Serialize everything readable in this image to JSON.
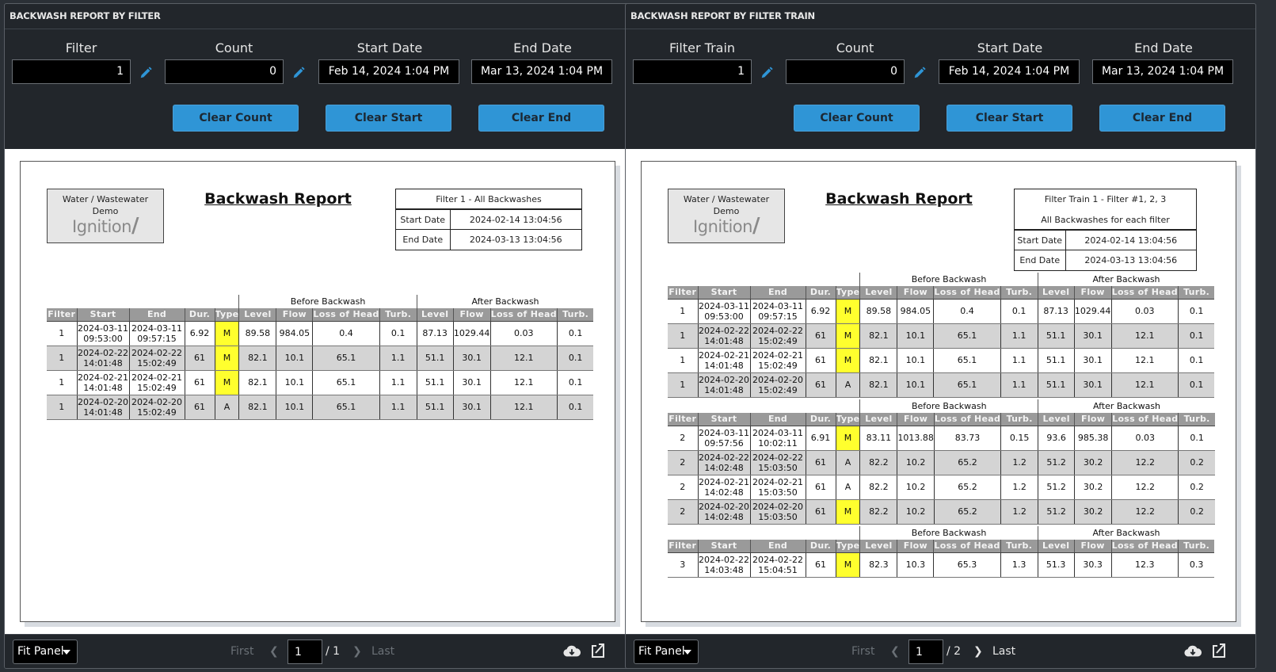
{
  "left": {
    "title": "BACKWASH REPORT BY FILTER",
    "controls": {
      "filter_label": "Filter",
      "filter_value": "1",
      "count_label": "Count",
      "count_value": "0",
      "start_label": "Start Date",
      "start_value": "Feb 14, 2024 1:04 PM",
      "end_label": "End Date",
      "end_value": "Mar 13, 2024 1:04 PM",
      "clear_count": "Clear Count",
      "clear_start": "Clear Start",
      "clear_end": "Clear End"
    },
    "report": {
      "logo_line1": "Water / Wastewater",
      "logo_line2": "Demo",
      "logo_brand": "Ignition",
      "title": "Backwash Report",
      "info_head": [
        "Filter 1 - All Backwashes"
      ],
      "start_label": "Start Date",
      "start_value": "2024-02-14 13:04:56",
      "end_label": "End Date",
      "end_value": "2024-03-13 13:04:56",
      "groups": [
        {
          "rows": [
            [
              "1",
              "2024-03-11",
              "09:53:00",
              "2024-03-11",
              "09:57:15",
              "6.92",
              "M",
              "89.58",
              "984.05",
              "0.4",
              "0.1",
              "87.13",
              "1029.44",
              "0.03",
              "0.1"
            ],
            [
              "1",
              "2024-02-22",
              "14:01:48",
              "2024-02-22",
              "15:02:49",
              "61",
              "M",
              "82.1",
              "10.1",
              "65.1",
              "1.1",
              "51.1",
              "30.1",
              "12.1",
              "0.1"
            ],
            [
              "1",
              "2024-02-21",
              "14:01:48",
              "2024-02-21",
              "15:02:49",
              "61",
              "M",
              "82.1",
              "10.1",
              "65.1",
              "1.1",
              "51.1",
              "30.1",
              "12.1",
              "0.1"
            ],
            [
              "1",
              "2024-02-20",
              "14:01:48",
              "2024-02-20",
              "15:02:49",
              "61",
              "A",
              "82.1",
              "10.1",
              "65.1",
              "1.1",
              "51.1",
              "30.1",
              "12.1",
              "0.1"
            ]
          ]
        }
      ]
    },
    "footer": {
      "zoom_mode": "Fit Panel",
      "first": "First",
      "last": "Last",
      "page": "1",
      "total": "/ 1"
    }
  },
  "right": {
    "title": "BACKWASH REPORT BY FILTER TRAIN",
    "controls": {
      "filter_label": "Filter Train",
      "filter_value": "1",
      "count_label": "Count",
      "count_value": "0",
      "start_label": "Start Date",
      "start_value": "Feb 14, 2024 1:04 PM",
      "end_label": "End Date",
      "end_value": "Mar 13, 2024 1:04 PM",
      "clear_count": "Clear Count",
      "clear_start": "Clear Start",
      "clear_end": "Clear End"
    },
    "report": {
      "logo_line1": "Water / Wastewater",
      "logo_line2": "Demo",
      "logo_brand": "Ignition",
      "title": "Backwash Report",
      "info_head": [
        "Filter Train 1 - Filter #1, 2, 3",
        "All Backwashes for each filter"
      ],
      "start_label": "Start Date",
      "start_value": "2024-02-14 13:04:56",
      "end_label": "End Date",
      "end_value": "2024-03-13 13:04:56",
      "groups": [
        {
          "rows": [
            [
              "1",
              "2024-03-11",
              "09:53:00",
              "2024-03-11",
              "09:57:15",
              "6.92",
              "M",
              "89.58",
              "984.05",
              "0.4",
              "0.1",
              "87.13",
              "1029.44",
              "0.03",
              "0.1"
            ],
            [
              "1",
              "2024-02-22",
              "14:01:48",
              "2024-02-22",
              "15:02:49",
              "61",
              "M",
              "82.1",
              "10.1",
              "65.1",
              "1.1",
              "51.1",
              "30.1",
              "12.1",
              "0.1"
            ],
            [
              "1",
              "2024-02-21",
              "14:01:48",
              "2024-02-21",
              "15:02:49",
              "61",
              "M",
              "82.1",
              "10.1",
              "65.1",
              "1.1",
              "51.1",
              "30.1",
              "12.1",
              "0.1"
            ],
            [
              "1",
              "2024-02-20",
              "14:01:48",
              "2024-02-20",
              "15:02:49",
              "61",
              "A",
              "82.1",
              "10.1",
              "65.1",
              "1.1",
              "51.1",
              "30.1",
              "12.1",
              "0.1"
            ]
          ]
        },
        {
          "rows": [
            [
              "2",
              "2024-03-11",
              "09:57:56",
              "2024-03-11",
              "10:02:11",
              "6.91",
              "M",
              "83.11",
              "1013.88",
              "83.73",
              "0.15",
              "93.6",
              "985.38",
              "0.03",
              "0.1"
            ],
            [
              "2",
              "2024-02-22",
              "14:02:48",
              "2024-02-22",
              "15:03:50",
              "61",
              "A",
              "82.2",
              "10.2",
              "65.2",
              "1.2",
              "51.2",
              "30.2",
              "12.2",
              "0.2"
            ],
            [
              "2",
              "2024-02-21",
              "14:02:48",
              "2024-02-21",
              "15:03:50",
              "61",
              "A",
              "82.2",
              "10.2",
              "65.2",
              "1.2",
              "51.2",
              "30.2",
              "12.2",
              "0.2"
            ],
            [
              "2",
              "2024-02-20",
              "14:02:48",
              "2024-02-20",
              "15:03:50",
              "61",
              "M",
              "82.2",
              "10.2",
              "65.2",
              "1.2",
              "51.2",
              "30.2",
              "12.2",
              "0.2"
            ]
          ]
        },
        {
          "rows": [
            [
              "3",
              "2024-02-22",
              "14:03:48",
              "2024-02-22",
              "15:04:51",
              "61",
              "M",
              "82.3",
              "10.3",
              "65.3",
              "1.3",
              "51.3",
              "30.3",
              "12.3",
              "0.3"
            ]
          ]
        }
      ]
    },
    "footer": {
      "zoom_mode": "Fit Panel",
      "first": "First",
      "last": "Last",
      "page": "1",
      "total": "/ 2"
    }
  },
  "table_labels": {
    "before": "Before Backwash",
    "after": "After Backwash",
    "columns": [
      "Filter",
      "Start",
      "End",
      "Dur.",
      "Type",
      "Level",
      "Flow",
      "Loss of Head",
      "Turb.",
      "Level",
      "Flow",
      "Loss of Head",
      "Turb."
    ]
  },
  "colors": {
    "accent": "#2f95d6",
    "manual_highlight": "#ffff2e",
    "header_gray": "#9a9a9a",
    "alt_row": "#d4d4d4"
  }
}
